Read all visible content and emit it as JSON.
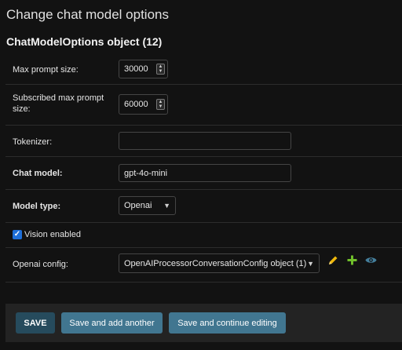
{
  "page": {
    "title": "Change chat model options",
    "subtitle": "ChatModelOptions object (12)"
  },
  "fields": {
    "max_prompt_size": {
      "label": "Max prompt size:",
      "value": "30000"
    },
    "subscribed_max_prompt_size": {
      "label_line1": "Subscribed max prompt",
      "label_line2": "size:",
      "value": "60000"
    },
    "tokenizer": {
      "label": "Tokenizer:",
      "value": ""
    },
    "chat_model": {
      "label": "Chat model:",
      "value": "gpt-4o-mini"
    },
    "model_type": {
      "label": "Model type:",
      "value": "Openai"
    },
    "vision_enabled": {
      "label": "Vision enabled",
      "checked": true
    },
    "openai_config": {
      "label": "Openai config:",
      "value": "OpenAIProcessorConversationConfig object (1)",
      "icons": [
        "pencil-icon",
        "plus-icon",
        "eye-icon"
      ]
    }
  },
  "buttons": {
    "save": "SAVE",
    "save_add_another": "Save and add another",
    "save_continue": "Save and continue editing"
  },
  "colors": {
    "accent_button": "#417690",
    "primary_button": "#264b5d",
    "pencil": "#efb80b",
    "plus": "#70bf2b",
    "eye": "#447e9b"
  }
}
